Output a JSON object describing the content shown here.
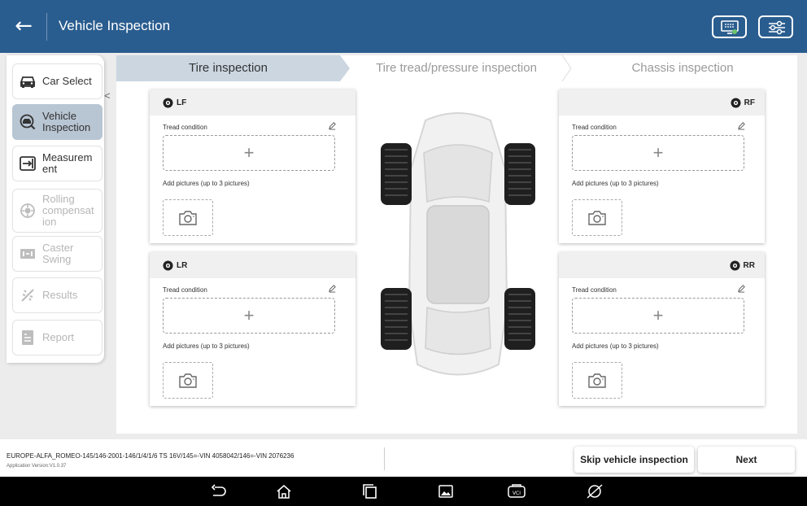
{
  "header": {
    "title": "Vehicle Inspection",
    "back_icon": "arrow-left-icon",
    "right_buttons": [
      "download-icon",
      "settings-sliders-icon"
    ]
  },
  "sidebar": {
    "items": [
      {
        "label": "Car Select",
        "icon": "car-icon",
        "state": "normal"
      },
      {
        "label": "Vehicle Inspection",
        "icon": "inspect-icon",
        "state": "active"
      },
      {
        "label": "Measurem ent",
        "icon": "measure-icon",
        "state": "normal"
      },
      {
        "label": "Rolling compensat ion",
        "icon": "rolling-icon",
        "state": "disabled"
      },
      {
        "label": "Caster Swing",
        "icon": "caster-icon",
        "state": "disabled"
      },
      {
        "label": "Results",
        "icon": "results-icon",
        "state": "disabled"
      },
      {
        "label": "Report",
        "icon": "report-icon",
        "state": "disabled"
      }
    ]
  },
  "steps": [
    "Tire inspection",
    "Tire tread/pressure inspection",
    "Chassis inspection"
  ],
  "cards": {
    "lf": {
      "badge": "LF",
      "tread_label": "Tread condition",
      "pictures_label": "Add pictures (up to 3 pictures)",
      "plus": "+"
    },
    "rf": {
      "badge": "RF",
      "tread_label": "Tread condition",
      "pictures_label": "Add pictures (up to 3 pictures)",
      "plus": "+"
    },
    "lr": {
      "badge": "LR",
      "tread_label": "Tread condition",
      "pictures_label": "Add pictures (up to 3 pictures)",
      "plus": "+"
    },
    "rr": {
      "badge": "RR",
      "tread_label": "Tread condition",
      "pictures_label": "Add pictures (up to 3 pictures)",
      "plus": "+"
    }
  },
  "footer": {
    "vehicle_info": "EUROPE-ALFA_ROMEO-145/146-2001-146/1/4/1/6 TS 16V/145=-VIN 4058042/146=-VIN 2076236",
    "app_version": "Application Version:V1.0.37",
    "skip_label": "Skip vehicle inspection",
    "next_label": "Next"
  },
  "colors": {
    "header_bg": "#2a5d8f",
    "active_step_bg": "#cbd6e1",
    "active_side_bg": "#b8c5d3"
  },
  "navbar_icons": [
    "back-icon",
    "home-icon",
    "recents-icon",
    "gallery-icon",
    "vci-icon",
    "browser-icon"
  ]
}
